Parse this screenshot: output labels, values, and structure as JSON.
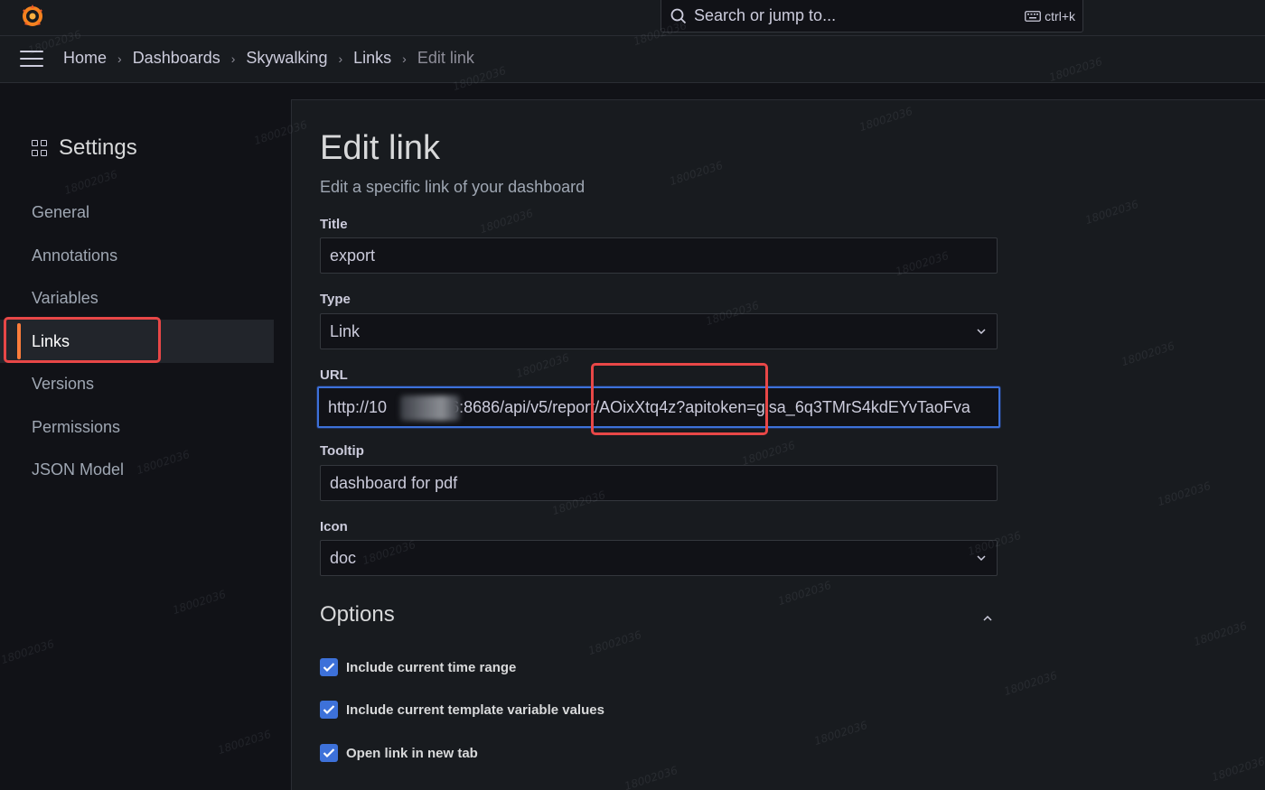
{
  "topbar": {
    "search_placeholder": "Search or jump to...",
    "search_shortcut": "ctrl+k"
  },
  "breadcrumb": {
    "items": [
      "Home",
      "Dashboards",
      "Skywalking",
      "Links"
    ],
    "current": "Edit link"
  },
  "sidebar": {
    "title": "Settings",
    "items": [
      {
        "label": "General"
      },
      {
        "label": "Annotations"
      },
      {
        "label": "Variables"
      },
      {
        "label": "Links",
        "active": true
      },
      {
        "label": "Versions"
      },
      {
        "label": "Permissions"
      },
      {
        "label": "JSON Model"
      }
    ]
  },
  "main": {
    "title": "Edit link",
    "subtitle": "Edit a specific link of your dashboard",
    "fields": {
      "title": {
        "label": "Title",
        "value": "export"
      },
      "type": {
        "label": "Type",
        "value": "Link"
      },
      "url": {
        "label": "URL",
        "value_prefix": "http://10",
        "value_suffix": "6:8686/api/v5/report/AOixXtq4z?apitoken=glsa_6q3TMrS4kdEYvTaoFva"
      },
      "tooltip": {
        "label": "Tooltip",
        "value": "dashboard for pdf"
      },
      "icon": {
        "label": "Icon",
        "value": "doc"
      }
    },
    "options": {
      "title": "Options",
      "checkboxes": [
        {
          "label": "Include current time range",
          "checked": true
        },
        {
          "label": "Include current template variable values",
          "checked": true
        },
        {
          "label": "Open link in new tab",
          "checked": true
        }
      ]
    }
  },
  "watermark": "18002036",
  "colors": {
    "background": "#111217",
    "panel": "#181b1f",
    "accent_blue": "#3d71d9",
    "active_bar": "#ff7d3b",
    "highlight_red": "#e84747"
  }
}
